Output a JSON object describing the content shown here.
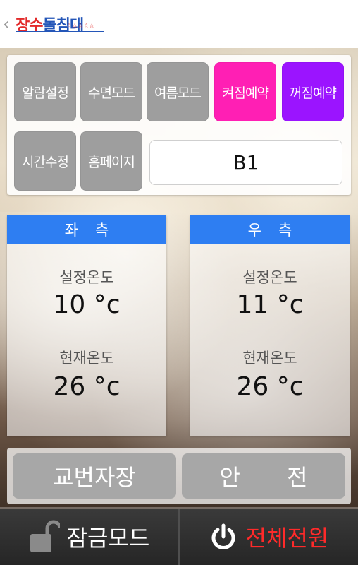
{
  "header": {
    "logo_red": "장수",
    "logo_blue": "돌",
    "logo_red2": "침대",
    "logo_stars": "☆☆☆☆☆"
  },
  "modes": {
    "alarm": "알람설정",
    "sleep": "수면모드",
    "summer": "여름모드",
    "on_reserve": "켜짐예약",
    "off_reserve": "꺼짐예약",
    "time_edit": "시간수정",
    "homepage": "홈페이지",
    "station": "B1"
  },
  "left_zone": {
    "title": "좌측",
    "set_label": "설정온도",
    "set_value": "10 °c",
    "current_label": "현재온도",
    "current_value": "26 °c"
  },
  "right_zone": {
    "title": "우측",
    "set_label": "설정온도",
    "set_value": "11 °c",
    "current_label": "현재온도",
    "current_value": "26 °c"
  },
  "actions": {
    "alternate": "교번자장",
    "safety": "안 전"
  },
  "bottom": {
    "lock": "잠금모드",
    "power": "전체전원"
  },
  "colors": {
    "accent_blue": "#2e7ef2",
    "on_reserve": "#ff1fb4",
    "off_reserve": "#9b14ff",
    "power_text": "#ff2a2a"
  }
}
